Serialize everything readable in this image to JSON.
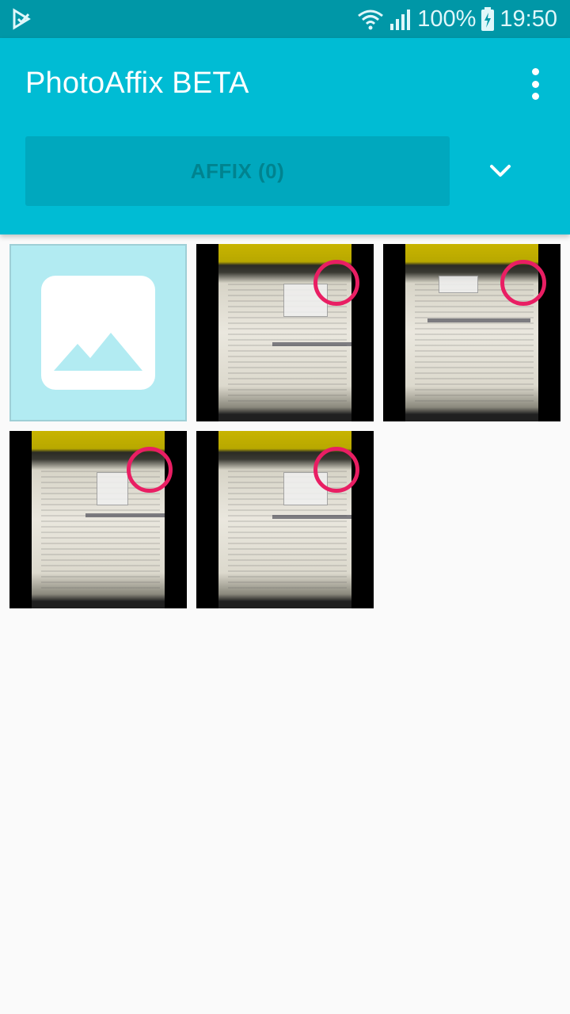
{
  "status_bar": {
    "battery": "100%",
    "time": "19:50",
    "icons": [
      "app-notification-icon",
      "wifi-icon",
      "signal-icon",
      "battery-charging-icon"
    ]
  },
  "app_bar": {
    "title": "PhotoAffix BETA",
    "affix_label": "AFFIX (0)",
    "menu_icon": "overflow-menu-icon",
    "expand_icon": "chevron-down-icon"
  },
  "colors": {
    "status_bar": "#0097a7",
    "primary": "#00bcd4",
    "accent": "#e91e63",
    "background": "#fafafa"
  },
  "grid": {
    "items": [
      {
        "kind": "placeholder",
        "icon": "image-placeholder-icon"
      },
      {
        "kind": "photo",
        "selected": false
      },
      {
        "kind": "photo",
        "selected": false
      },
      {
        "kind": "photo",
        "selected": false
      },
      {
        "kind": "photo",
        "selected": false
      }
    ]
  }
}
